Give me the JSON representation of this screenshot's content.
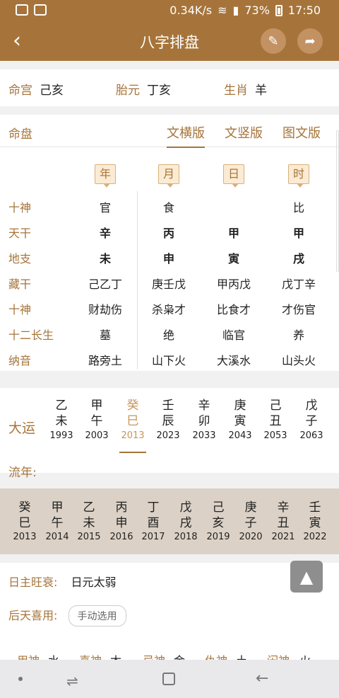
{
  "status": {
    "speed": "0.34K/s",
    "battery": "73%",
    "time": "17:50"
  },
  "appbar": {
    "title": "八字排盘",
    "back_icon": "chevron-left-icon",
    "edit_icon": "pencil-icon",
    "share_icon": "share-icon"
  },
  "info": {
    "minggong_label": "命宫",
    "minggong_value": "己亥",
    "taiyuan_label": "胎元",
    "taiyuan_value": "丁亥",
    "shengxiao_label": "生肖",
    "shengxiao_value": "羊"
  },
  "mingpan": {
    "label": "命盘",
    "tabs": [
      "文横版",
      "文竖版",
      "图文版"
    ],
    "columns": [
      "年",
      "月",
      "日",
      "时"
    ],
    "rows": [
      {
        "label": "十神",
        "cells": [
          "官",
          "食",
          "",
          "比"
        ],
        "bold": false
      },
      {
        "label": "天干",
        "cells": [
          "辛",
          "丙",
          "甲",
          "甲"
        ],
        "bold": true
      },
      {
        "label": "地支",
        "cells": [
          "未",
          "申",
          "寅",
          "戌"
        ],
        "bold": true
      },
      {
        "label": "藏干",
        "cells": [
          "己乙丁",
          "庚壬戊",
          "甲丙戊",
          "戊丁辛"
        ],
        "bold": false
      },
      {
        "label": "十神",
        "cells": [
          "财劫伤",
          "杀枭才",
          "比食才",
          "才伤官"
        ],
        "bold": false
      },
      {
        "label": "十二长生",
        "cells": [
          "墓",
          "绝",
          "临官",
          "养"
        ],
        "bold": false
      },
      {
        "label": "纳音",
        "cells": [
          "路旁土",
          "山下火",
          "大溪水",
          "山头火"
        ],
        "bold": false
      }
    ]
  },
  "dayun": {
    "label": "大运",
    "items": [
      {
        "gan": "乙",
        "zhi": "未",
        "year": "1993"
      },
      {
        "gan": "甲",
        "zhi": "午",
        "year": "2003"
      },
      {
        "gan": "癸",
        "zhi": "巳",
        "year": "2013"
      },
      {
        "gan": "壬",
        "zhi": "辰",
        "year": "2023"
      },
      {
        "gan": "辛",
        "zhi": "卯",
        "year": "2033"
      },
      {
        "gan": "庚",
        "zhi": "寅",
        "year": "2043"
      },
      {
        "gan": "己",
        "zhi": "丑",
        "year": "2053"
      },
      {
        "gan": "戊",
        "zhi": "子",
        "year": "2063"
      }
    ],
    "selected_index": 2,
    "liunian_label": "流年:"
  },
  "liunian": [
    {
      "gan": "癸",
      "zhi": "巳",
      "year": "2013"
    },
    {
      "gan": "甲",
      "zhi": "午",
      "year": "2014"
    },
    {
      "gan": "乙",
      "zhi": "未",
      "year": "2015"
    },
    {
      "gan": "丙",
      "zhi": "申",
      "year": "2016"
    },
    {
      "gan": "丁",
      "zhi": "酉",
      "year": "2017"
    },
    {
      "gan": "戊",
      "zhi": "戌",
      "year": "2018"
    },
    {
      "gan": "己",
      "zhi": "亥",
      "year": "2019"
    },
    {
      "gan": "庚",
      "zhi": "子",
      "year": "2020"
    },
    {
      "gan": "辛",
      "zhi": "丑",
      "year": "2021"
    },
    {
      "gan": "壬",
      "zhi": "寅",
      "year": "2022"
    }
  ],
  "analysis": {
    "wangshuai_label": "日主旺衰:",
    "wangshuai_value": "日元太弱",
    "xiyong_label": "后天喜用:",
    "manual_select": "手动选用",
    "partial": [
      "用神",
      "水",
      "喜神",
      "木",
      "忌神",
      "金",
      "仇神",
      "土",
      "闲神",
      "火"
    ]
  },
  "fab_icon": "arrow-up-icon"
}
